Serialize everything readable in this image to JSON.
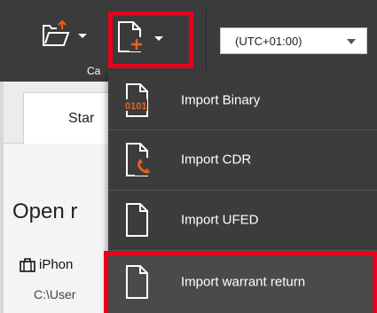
{
  "toolbar": {
    "open_case_icon": "folder-open-arrow-icon",
    "new_case_icon": "new-file-plus-icon",
    "group_label": "Ca",
    "timezone": {
      "selected": "(UTC+01:00)"
    }
  },
  "page": {
    "tab_label": "Star",
    "heading": "Open r",
    "recent_item_label": "iPhon",
    "recent_item_path": "C:\\User"
  },
  "menu": {
    "items": [
      {
        "label": "Import Binary",
        "icon": "binary-file-icon"
      },
      {
        "label": "Import CDR",
        "icon": "phone-file-icon"
      },
      {
        "label": "Import UFED",
        "icon": "document-icon"
      },
      {
        "label": "Import warrant return",
        "icon": "document-icon"
      }
    ]
  },
  "colors": {
    "toolbar_bg": "#3b3b3b",
    "menu_bg": "#3c3c3c",
    "highlight_red": "#e8001c",
    "accent_orange": "#e8601c"
  }
}
